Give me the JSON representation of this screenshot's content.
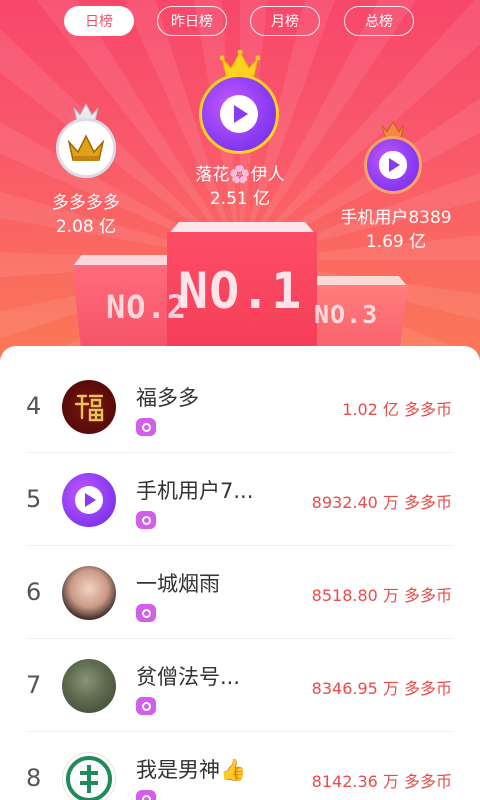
{
  "tabs": [
    {
      "label": "日榜",
      "active": true
    },
    {
      "label": "昨日榜",
      "active": false
    },
    {
      "label": "月榜",
      "active": false
    },
    {
      "label": "总榜",
      "active": false
    }
  ],
  "podium": {
    "labels": {
      "first": "NO.1",
      "second": "NO.2",
      "third": "NO.3"
    },
    "first": {
      "name": "落花🌸伊人",
      "score": "2.51 亿",
      "avatar": "app-logo"
    },
    "second": {
      "name": "多多多多",
      "score": "2.08 亿",
      "avatar": "gold-crown"
    },
    "third": {
      "name": "手机用户8389",
      "score": "1.69 亿",
      "avatar": "app-logo"
    }
  },
  "list": [
    {
      "rank": "4",
      "name": "福多多",
      "score": "1.02 亿  多多币",
      "avatar": "fu-character"
    },
    {
      "rank": "5",
      "name": "手机用户7...",
      "score": "8932.40 万  多多币",
      "avatar": "app-logo"
    },
    {
      "rank": "6",
      "name": "一城烟雨",
      "score": "8518.80 万  多多币",
      "avatar": "woman-photo"
    },
    {
      "rank": "7",
      "name": "贫僧法号...",
      "score": "8346.95 万  多多币",
      "avatar": "soldier-photo"
    },
    {
      "rank": "8",
      "name": "我是男神👍",
      "score": "8142.36 万  多多币",
      "avatar": "bank-logo"
    }
  ],
  "colors": {
    "accent": "#f2506a",
    "score": "#ea4b4a",
    "badge": "#d25ee9",
    "logo": "#8a3bf2"
  }
}
